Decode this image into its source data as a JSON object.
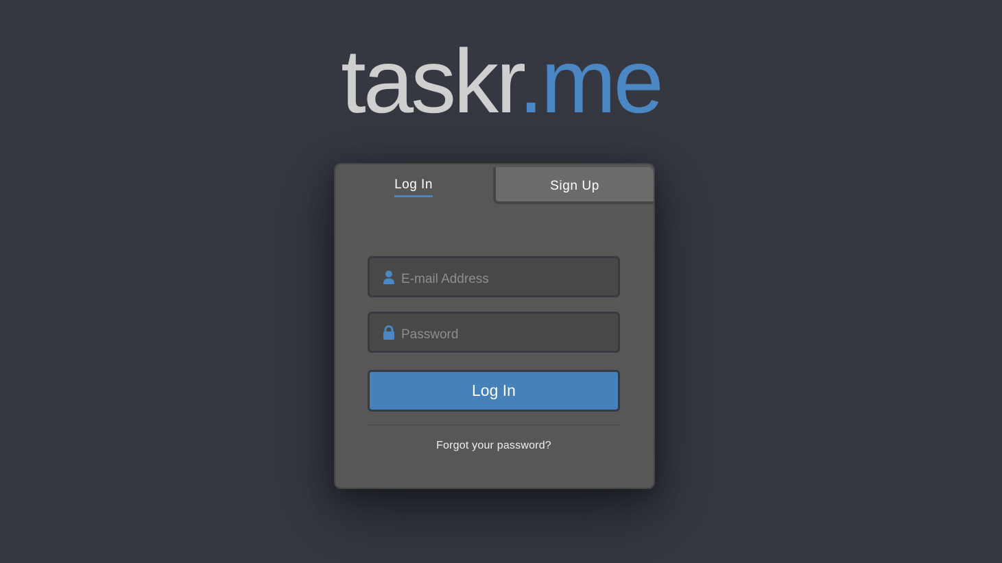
{
  "logo": {
    "main": "taskr",
    "accent": ".me"
  },
  "tabs": {
    "login": "Log In",
    "signup": "Sign Up"
  },
  "form": {
    "email": {
      "placeholder": "E-mail Address",
      "value": "",
      "icon": "user-icon"
    },
    "password": {
      "placeholder": "Password",
      "value": "",
      "icon": "lock-icon"
    },
    "submit_label": "Log In",
    "forgot_label": "Forgot your password?"
  },
  "colors": {
    "background": "#353841",
    "card": "#575757",
    "accent": "#4a87c4",
    "button": "#4682b9",
    "logo_main": "#cfcfcf"
  }
}
